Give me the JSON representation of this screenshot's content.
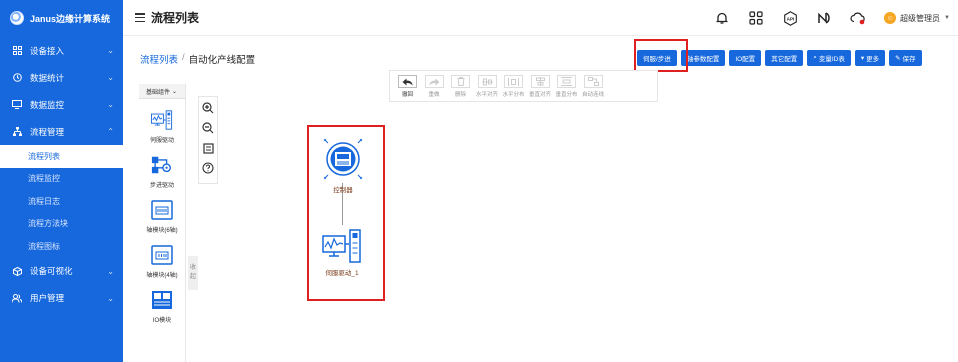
{
  "app": {
    "name": "Janus边缘计算系统"
  },
  "header": {
    "title": "流程列表",
    "user": "超级管理员"
  },
  "sidebar": {
    "items": [
      {
        "label": "设备接入"
      },
      {
        "label": "数据统计"
      },
      {
        "label": "数据监控"
      },
      {
        "label": "流程管理",
        "children": [
          "流程列表",
          "流程监控",
          "流程日志",
          "流程方法块",
          "流程图标"
        ]
      },
      {
        "label": "设备可视化"
      },
      {
        "label": "用户管理"
      }
    ]
  },
  "breadcrumb": {
    "parent": "流程列表",
    "separator": "/",
    "current": "自动化产线配置"
  },
  "actions": [
    "伺服/步进",
    "轴参数配置",
    "IO配置",
    "其它配置",
    "变量ID表",
    "更多",
    "保存"
  ],
  "toolbar": [
    "撤回",
    "重做",
    "删除",
    "水平对齐",
    "水平分布",
    "垂直对齐",
    "垂直分布",
    "自动连线"
  ],
  "panel": {
    "title": "基础组件",
    "items": [
      "伺服驱动",
      "步进驱动",
      "轴模块(6轴)",
      "轴模块(4轴)",
      "IO模块"
    ],
    "collapse": [
      "收",
      "起"
    ]
  },
  "canvas": {
    "nodes": [
      "控制器",
      "伺服驱动_1"
    ]
  },
  "colors": {
    "primary": "#1668dc",
    "highlight": "#e02020"
  }
}
